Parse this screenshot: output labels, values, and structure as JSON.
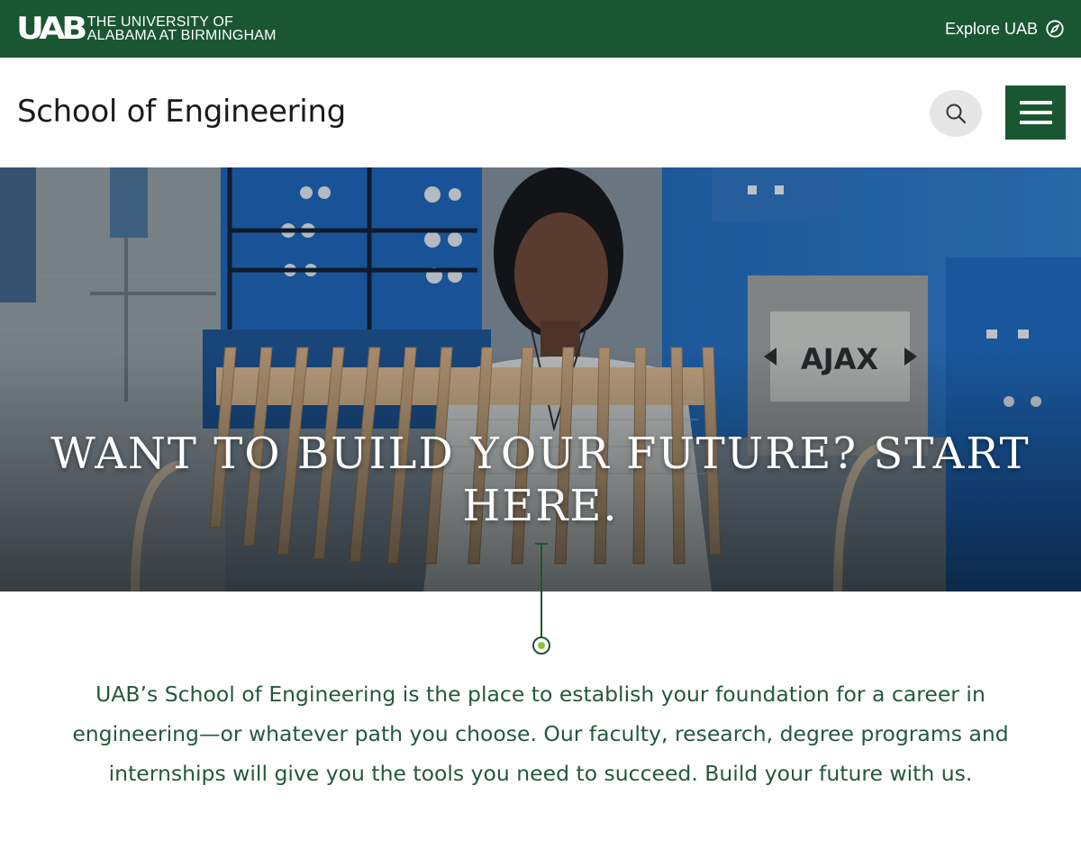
{
  "brand": {
    "mark": "UAB",
    "line1": "The University of",
    "line2": "Alabama at Birmingham"
  },
  "topnav": {
    "explore_label": "Explore UAB",
    "explore_icon": "compass-icon"
  },
  "header": {
    "title": "School of Engineering",
    "search_icon": "search-icon",
    "menu_icon": "hamburger-menu-icon"
  },
  "hero": {
    "headline": "WANT TO BUILD YOUR FUTURE? START HERE.",
    "ajax_label": "AJAX"
  },
  "intro": {
    "text": "UAB’s School of Engineering is the place to establish your foundation for a career in engineering—or whatever path you choose. Our faculty, research, degree programs and internships will give you the tools you need to succeed. Build your future with us."
  },
  "colors": {
    "brand_green": "#1a5632",
    "accent_green": "#8fbf3f",
    "intro_text": "#24583f"
  }
}
